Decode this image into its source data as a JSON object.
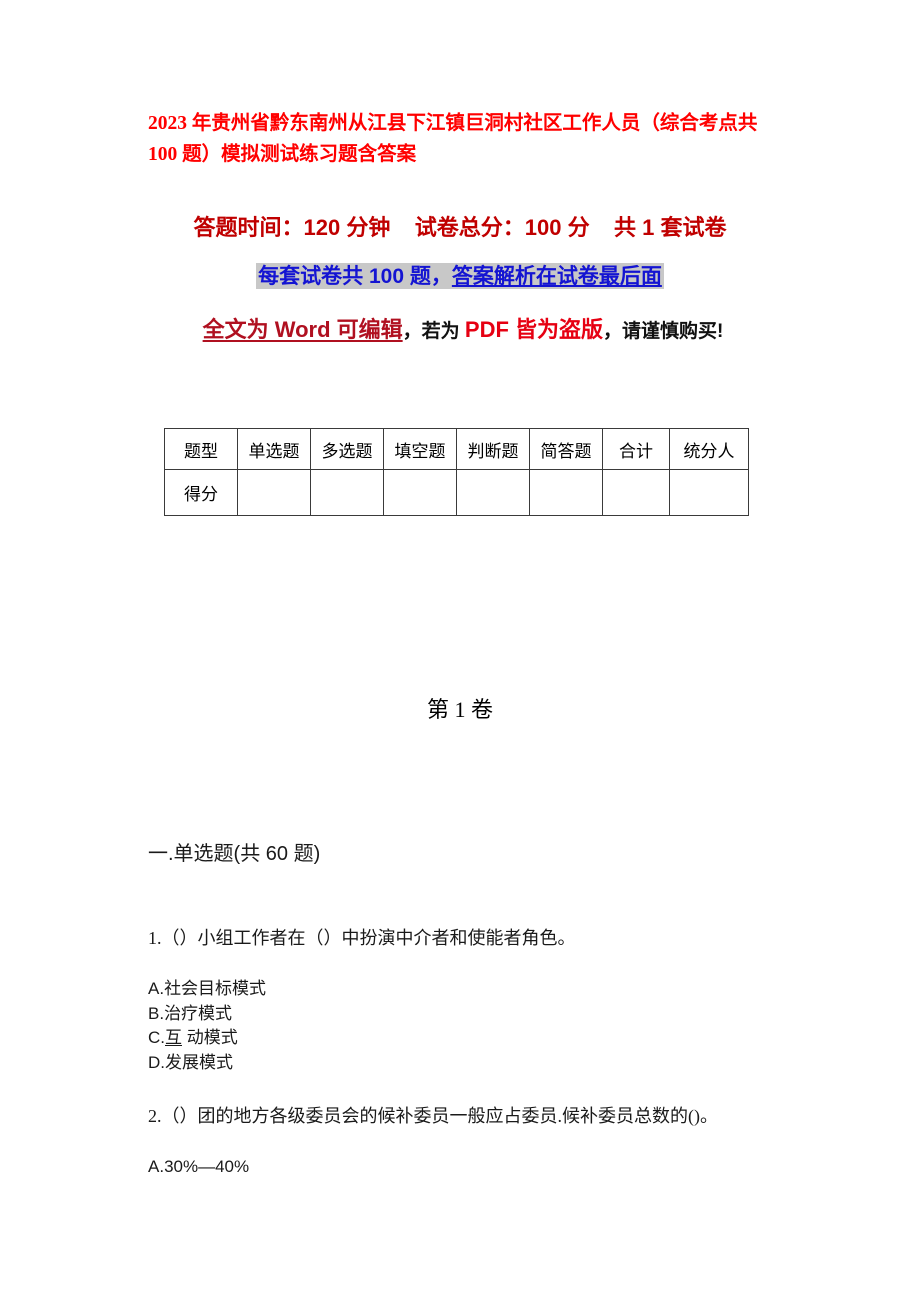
{
  "document": {
    "title": "2023 年贵州省黔东南州从江县下江镇巨洞村社区工作人员（综合考点共 100 题）模拟测试练习题含答案",
    "header_line_1": "答题时间：120 分钟    试卷总分：100 分    共 1 套试卷",
    "header_line_2": {
      "part_plain": "每套试卷共 100 题，",
      "part_underlined": "答案解析在试卷最后面"
    },
    "header_line_3": {
      "word_red": "全文为 Word 可编辑",
      "sep_1": "，若为 ",
      "pdf_red": "PDF 皆为盗版",
      "sep_2": "，请谨慎购买!"
    },
    "volume_heading": "第 1 卷"
  },
  "score_table": {
    "headers": [
      "题型",
      "单选题",
      "多选题",
      "填空题",
      "判断题",
      "简答题",
      "合计",
      "统分人"
    ],
    "row_label": "得分",
    "row_values": [
      "",
      "",
      "",
      "",
      "",
      "",
      ""
    ]
  },
  "section": {
    "heading": "一.单选题(共 60 题)"
  },
  "questions": [
    {
      "number": "1.",
      "stem": "1.（）小组工作者在（）中扮演中介者和使能者角色。",
      "options": [
        {
          "prefix": "A.",
          "text": "社会目标模式",
          "underlined": ""
        },
        {
          "prefix": "B.",
          "text": "治疗模式",
          "underlined": ""
        },
        {
          "prefix": "C.",
          "text": " 动模式",
          "underlined": "互"
        },
        {
          "prefix": "D.",
          "text": "发展模式",
          "underlined": ""
        }
      ]
    },
    {
      "number": "2.",
      "stem": "2.（）团的地方各级委员会的候补委员一般应占委员.候补委员总数的()。",
      "options": [
        {
          "prefix": "A.",
          "text": "30%—40%",
          "underlined": ""
        }
      ]
    }
  ],
  "colors": {
    "title_red": "#ff0000",
    "header_dark_red": "#c00000",
    "header_blue": "#1414d2",
    "highlight_gray": "#c8c8c8",
    "word_crimson": "#b01020",
    "pdf_red": "#e60012",
    "body_text": "#1a1a1a",
    "table_border": "#3a3a3a",
    "page_background": "#ffffff"
  }
}
